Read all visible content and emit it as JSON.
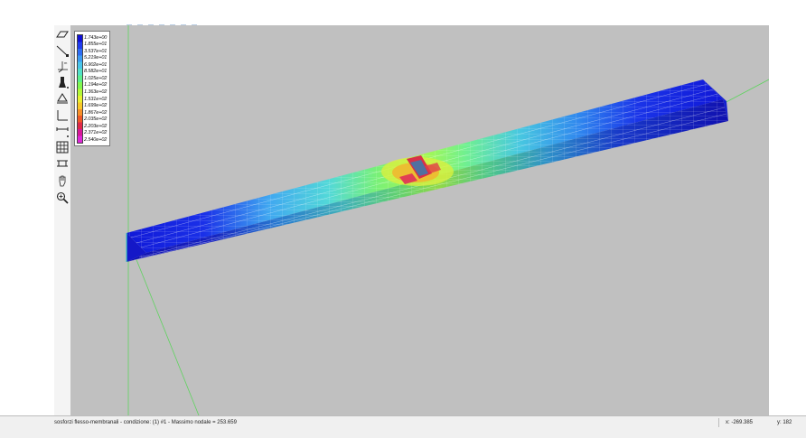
{
  "legend": {
    "labels": [
      "1.743e+00",
      "1.855e+01",
      "3.537e+01",
      "5.219e+01",
      "6.902e+01",
      "8.582e+01",
      "1.025e+02",
      "1.194e+02",
      "1.363e+02",
      "1.531e+02",
      "1.699e+02",
      "1.867e+02",
      "2.035e+02",
      "2.203e+02",
      "2.371e+02",
      "2.540e+02"
    ],
    "colors": [
      "#1010d8",
      "#1f3cef",
      "#2d6cf4",
      "#3c9cf2",
      "#48c5ea",
      "#52e0c8",
      "#5cf08c",
      "#80f850",
      "#b4f838",
      "#e8f030",
      "#f8c828",
      "#f89028",
      "#f05828",
      "#e02848",
      "#d81898",
      "#e028d8"
    ]
  },
  "toolbar": {
    "icons": [
      "plane-icon",
      "line-icon",
      "axes-icon",
      "paint-icon",
      "support-icon",
      "dimension-icon",
      "measure-icon",
      "mesh-icon",
      "beam-icon",
      "pan-icon",
      "zoom-icon"
    ]
  },
  "viewport": {
    "axis_color": "#5fd35f"
  },
  "status": {
    "text": "sosforzi flesso-membranali - condizione: (1) #1 - Massimo nodale = 253.659",
    "x": "x: -269.385",
    "y": "y: 182"
  }
}
